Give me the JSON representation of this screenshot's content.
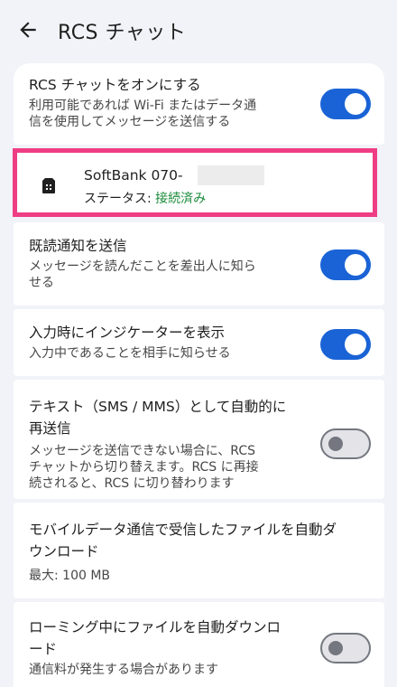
{
  "appbar": {
    "title": "RCS チャット"
  },
  "rcs_toggle": {
    "title": "RCS チャットをオンにする",
    "subtitle_line1": "利用可能であれば Wi-Fi またはデータ通",
    "subtitle_line2": "信を使用してメッセージを送信する",
    "enabled": true
  },
  "sim": {
    "name": "SoftBank 070-",
    "status_label": "ステータス: ",
    "status_value": "接続済み"
  },
  "read_receipts": {
    "title": "既読通知を送信",
    "subtitle_line1": "メッセージを読んだことを差出人に知ら",
    "subtitle_line2": "せる",
    "enabled": true
  },
  "typing_indicator": {
    "title": "入力時にインジケーターを表示",
    "subtitle": "入力中であることを相手に知らせる",
    "enabled": true
  },
  "resend_sms": {
    "title_line1": "テキスト（SMS / MMS）として自動的に",
    "title_line2": "再送信",
    "subtitle_line1": "メッセージを送信できない場合に、RCS",
    "subtitle_line2": "チャットから切り替えます。RCS に再接",
    "subtitle_line3": "続されると、RCS に切り替わります",
    "enabled": false
  },
  "auto_download_mobile": {
    "title_line1": "モバイルデータ通信で受信したファイルを自動ダ",
    "title_line2": "ウンロード",
    "subtitle": "最大: 100 MB"
  },
  "roaming_download": {
    "title_line1": "ローミング中にファイルを自動ダウンロ",
    "title_line2": "ード",
    "subtitle": "通信料が発生する場合があります",
    "enabled": false
  },
  "colors": {
    "accent": "#1a63d6",
    "highlight": "#ef3d84",
    "status_ok": "#1a8a3a"
  }
}
